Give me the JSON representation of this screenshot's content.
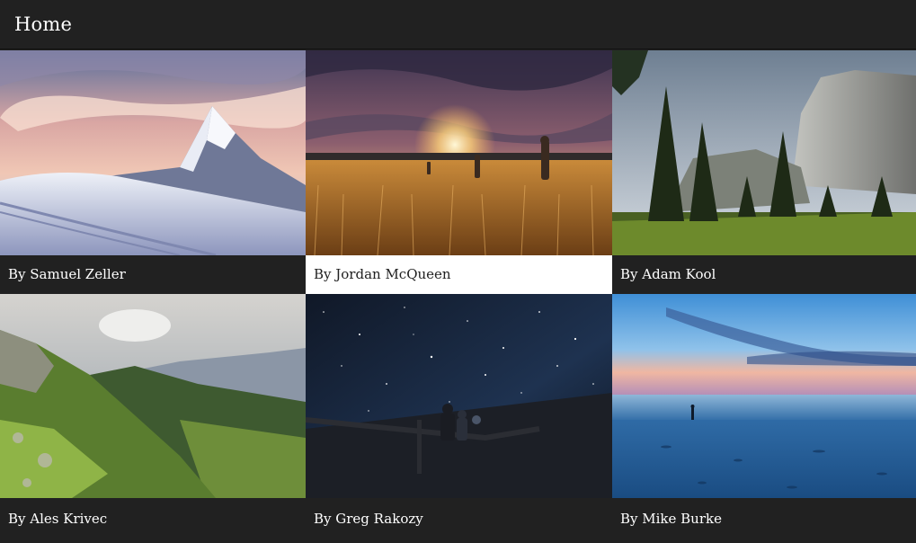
{
  "app_bar": {
    "title": "Home"
  },
  "gallery": {
    "selected_index": 1,
    "tiles": [
      {
        "caption": "By Samuel Zeller",
        "scene": "snowy-mountain-peak-icon"
      },
      {
        "caption": "By Jordan McQueen",
        "scene": "sunset-wheat-field-icon"
      },
      {
        "caption": "By Adam Kool",
        "scene": "granite-cliff-forest-icon"
      },
      {
        "caption": "By Ales Krivec",
        "scene": "green-mountain-valley-icon"
      },
      {
        "caption": "By Greg Rakozy",
        "scene": "starry-night-sky-icon"
      },
      {
        "caption": "By Mike Burke",
        "scene": "blue-beach-dusk-icon"
      }
    ]
  },
  "colors": {
    "bar_background": "#212121",
    "caption_background": "#212121",
    "caption_text": "#ffffff",
    "selected_caption_background": "#ffffff",
    "selected_caption_text": "#212121"
  }
}
